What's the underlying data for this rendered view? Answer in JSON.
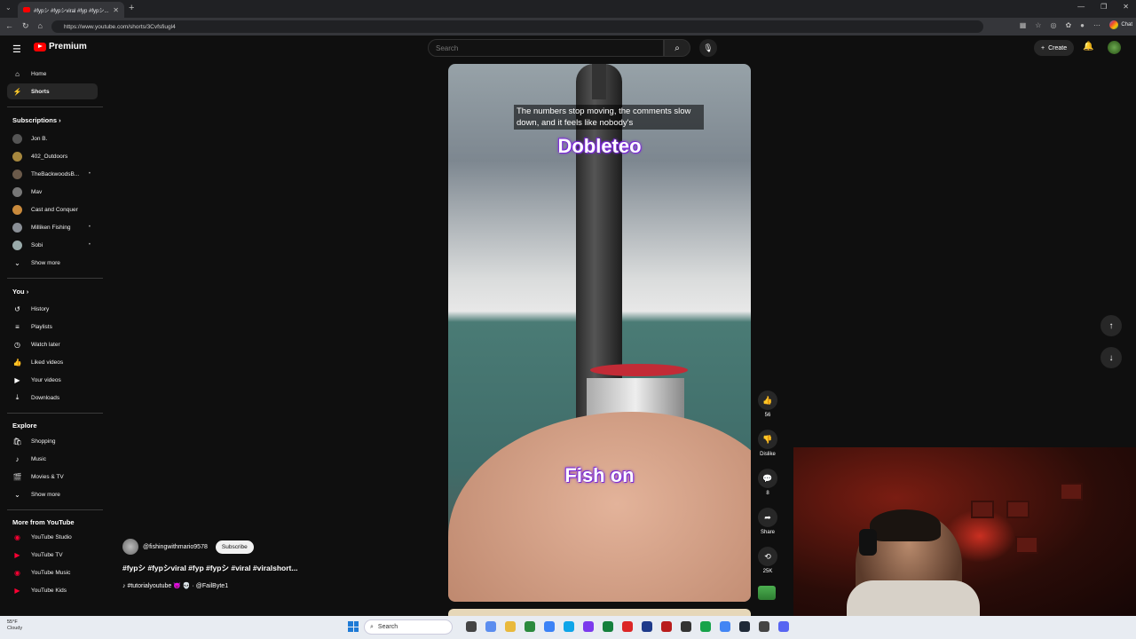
{
  "browser": {
    "tab_title": "#fypシ #fypシviral #fyp #fypシ...",
    "url": "https://www.youtube.com/shorts/3Cvfsfiugl4",
    "chat_label": "Chat"
  },
  "header": {
    "logo_text": "Premium",
    "search_placeholder": "Search",
    "create_label": "Create"
  },
  "sidebar": {
    "main": [
      {
        "label": "Home",
        "icon": "home-icon"
      },
      {
        "label": "Shorts",
        "icon": "shorts-icon"
      }
    ],
    "subscriptions_header": "Subscriptions",
    "subscriptions": [
      {
        "label": "Jon B."
      },
      {
        "label": "402_Outdoors"
      },
      {
        "label": "TheBackwoodsB..."
      },
      {
        "label": "Mav"
      },
      {
        "label": "Cast and Conquer"
      },
      {
        "label": "Milliken Fishing"
      },
      {
        "label": "Sobi"
      }
    ],
    "subs_show_more": "Show more",
    "you_header": "You",
    "you": [
      {
        "label": "History",
        "icon": "history-icon"
      },
      {
        "label": "Playlists",
        "icon": "playlists-icon"
      },
      {
        "label": "Watch later",
        "icon": "watch-later-icon"
      },
      {
        "label": "Liked videos",
        "icon": "liked-icon"
      },
      {
        "label": "Your videos",
        "icon": "your-videos-icon"
      },
      {
        "label": "Downloads",
        "icon": "download-icon"
      }
    ],
    "explore_header": "Explore",
    "explore": [
      {
        "label": "Shopping",
        "icon": "shopping-icon"
      },
      {
        "label": "Music",
        "icon": "music-icon"
      },
      {
        "label": "Movies & TV",
        "icon": "movies-icon"
      }
    ],
    "explore_show_more": "Show more",
    "more_header": "More from YouTube",
    "more": [
      {
        "label": "YouTube Studio"
      },
      {
        "label": "YouTube TV"
      },
      {
        "label": "YouTube Music"
      },
      {
        "label": "YouTube Kids"
      }
    ]
  },
  "short": {
    "caption_small": "The numbers stop moving, the comments slow down, and it feels like nobody's",
    "caption_top": "Dobleteo",
    "caption_bottom": "Fish on",
    "channel": "@fishingwithmario9578",
    "subscribe_label": "Subscribe",
    "title": "#fypシ #fypシviral #fyp #fypシ #viral #viralshort...",
    "sound": "♪ #tutorialyoutube 😈 💀 · @FailByte1"
  },
  "actions": {
    "likes": "56",
    "dislike": "Dislike",
    "comments": "8",
    "share": "Share",
    "remix": "25K"
  },
  "taskbar": {
    "temp": "55°F",
    "condition": "Cloudy",
    "search": "Search"
  }
}
